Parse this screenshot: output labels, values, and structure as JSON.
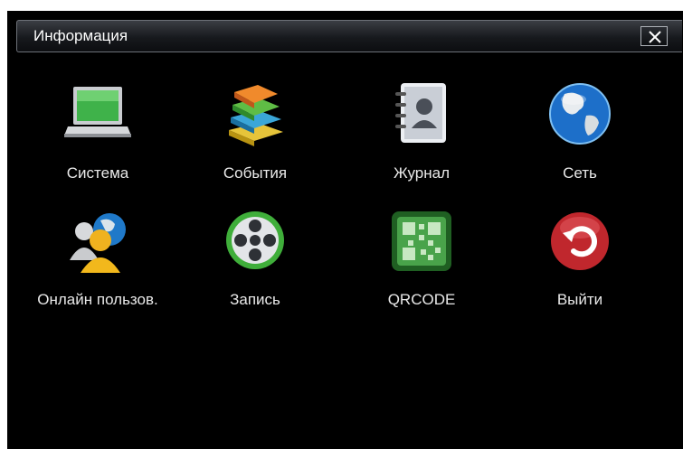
{
  "window": {
    "title": "Информация"
  },
  "menu": {
    "items": [
      {
        "label": "Система",
        "icon": "laptop-icon"
      },
      {
        "label": "События",
        "icon": "books-icon"
      },
      {
        "label": "Журнал",
        "icon": "address-book-icon"
      },
      {
        "label": "Сеть",
        "icon": "globe-icon"
      },
      {
        "label": "Онлайн пользов.",
        "icon": "online-users-icon"
      },
      {
        "label": "Запись",
        "icon": "film-reel-icon"
      },
      {
        "label": "QRCODE",
        "icon": "qrcode-icon"
      },
      {
        "label": "Выйти",
        "icon": "exit-icon"
      }
    ]
  },
  "colors": {
    "background": "#000000",
    "text": "#e9e9e9",
    "exit_red": "#c0272d",
    "qr_green": "#3a9b3c"
  }
}
